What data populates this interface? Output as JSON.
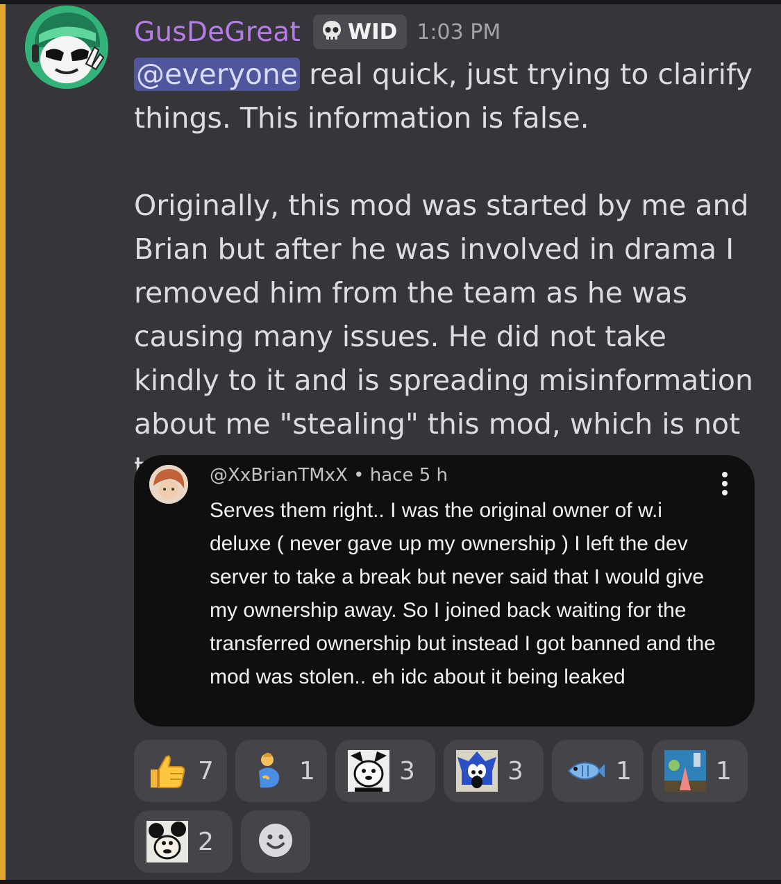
{
  "message": {
    "username": "GusDeGreat",
    "tag": {
      "icon": "skull-icon",
      "text": "WID"
    },
    "timestamp": "1:03 PM",
    "mention": "@everyone",
    "line1_rest": " real quick, just trying to clairify things. This information is false.",
    "paragraph2": "Originally, this mod was started by me and Brian but after he was involved in drama I removed him from the team as he was causing many issues. He did not take kindly to it and is spreading misinformation about me \"stealing\" this mod, which is not true."
  },
  "embed": {
    "author": "@XxBrianTMxX",
    "separator": "•",
    "time": "hace 5 h",
    "text": "Serves them right.. I was the original owner of w.i deluxe ( never gave up my ownership ) I left the dev server to take a break but never said that I would give my ownership away. So I joined back waiting for the transferred ownership but instead I got banned and the mod was stolen.. eh idc about it being leaked"
  },
  "reactions": [
    {
      "icon": "thumbs-up-icon",
      "count": "7"
    },
    {
      "icon": "pregnant-man-icon",
      "count": "1"
    },
    {
      "icon": "cartoon-face-icon",
      "count": "3"
    },
    {
      "icon": "sonic-face-icon",
      "count": "3"
    },
    {
      "icon": "blowfish-icon",
      "count": "1"
    },
    {
      "icon": "patrick-meme-icon",
      "count": "1"
    },
    {
      "icon": "mickey-face-icon",
      "count": "2"
    }
  ],
  "colors": {
    "background": "#36353a",
    "mention_bar": "#e5a52d",
    "username": "#b47de8",
    "mention_bg": "#4f569c",
    "embed_bg": "#0f0f0f",
    "reaction_bg": "#454449"
  }
}
